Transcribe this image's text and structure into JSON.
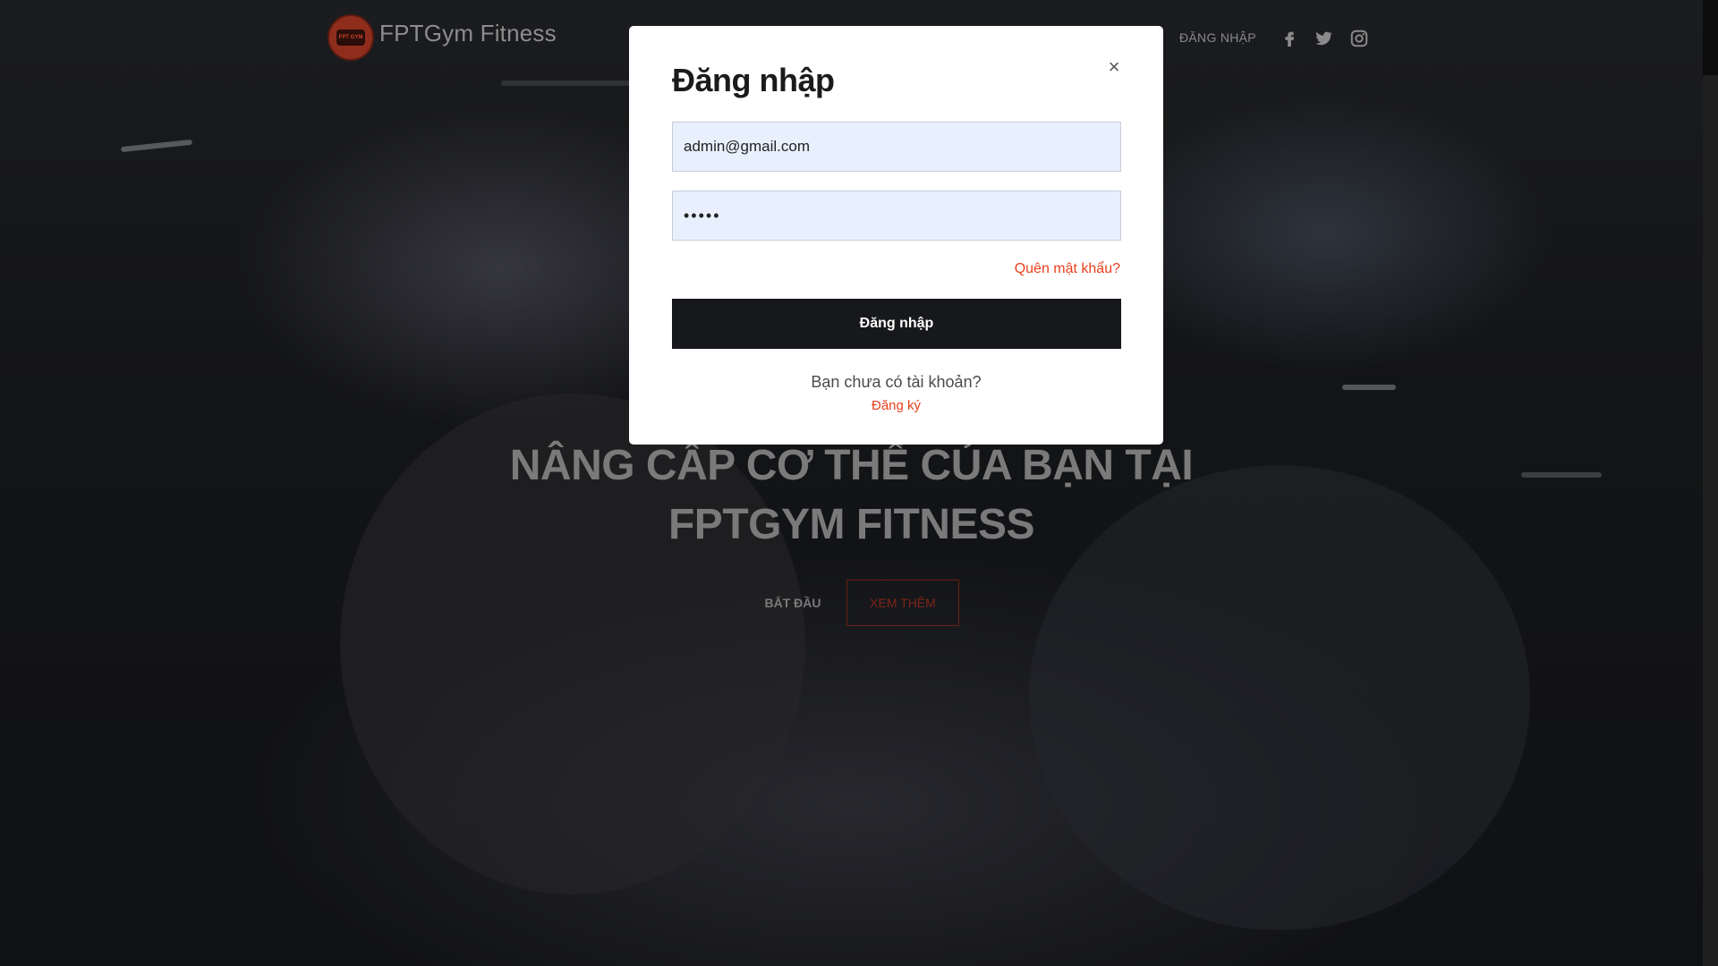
{
  "header": {
    "brand": "FPTGym Fitness",
    "logo_text": "FPT GYM",
    "login_link": "ĐĂNG NHẬP",
    "social": [
      "facebook-icon",
      "twitter-icon",
      "instagram-icon"
    ]
  },
  "hero": {
    "title_line1": "NÂNG CẤP CƠ THỂ CỦA BẠN TẠI",
    "title_line2": "FPTGYM FITNESS",
    "start_button": "BẮT ĐẦU",
    "more_button": "XEM THÊM"
  },
  "modal": {
    "title": "Đăng nhập",
    "close_label": "×",
    "email_value": "admin@gmail.com",
    "password_value": "•••••",
    "forgot_link": "Quên mật khẩu?",
    "submit_label": "Đăng nhập",
    "no_account_text": "Bạn chưa có tài khoản?",
    "register_link": "Đăng ký"
  },
  "colors": {
    "accent": "#e8401c",
    "button_dark": "#17181b",
    "input_bg": "#e8f0fe"
  }
}
